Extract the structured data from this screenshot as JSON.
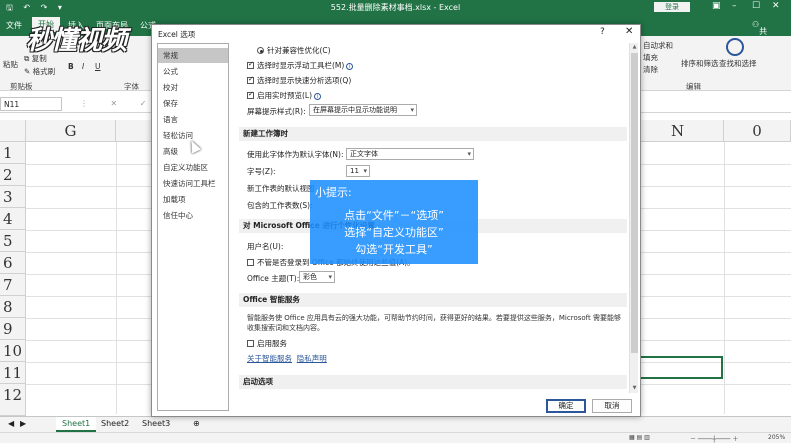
{
  "app": {
    "doc_title": "552.批量删除素材事档.xlsx  -  Excel",
    "login_label": "登录",
    "share_label": "共享",
    "tabs": [
      "文件",
      "开始",
      "插入",
      "页面布局",
      "公式"
    ],
    "brand_color": "#217346"
  },
  "ribbon": {
    "paste_label": "粘贴",
    "copy_label": "复制",
    "format_painter_label": "格式刷",
    "clipboard_group": "剪贴板",
    "bold": "B",
    "italic": "I",
    "underline": "U",
    "font_group": "字体",
    "autosum_label": "自动求和",
    "fill_label": "填充",
    "clear_label": "清除",
    "sort_label": "排序和筛选",
    "find_label": "查找和选择",
    "edit_group": "编辑",
    "watermark": "秒懂视频"
  },
  "formula_bar": {
    "name_box": "N11",
    "fx": "fx"
  },
  "grid": {
    "col_G": "G",
    "col_N": "N",
    "col_O": "0",
    "rows": [
      "1",
      "2",
      "3",
      "4",
      "5",
      "6",
      "7",
      "8",
      "9",
      "10",
      "11",
      "12"
    ]
  },
  "sheets": [
    "Sheet1",
    "Sheet2",
    "Sheet3"
  ],
  "status": {
    "zoom": "205%"
  },
  "dialog": {
    "title": "Excel 选项",
    "help": "?",
    "close": "✕",
    "nav": [
      "常规",
      "公式",
      "校对",
      "保存",
      "语言",
      "轻松访问",
      "高级",
      "自定义功能区",
      "快速访问工具栏",
      "加载项",
      "信任中心"
    ],
    "active_nav": "常规",
    "options": {
      "compat": "针对兼容性优化(C)",
      "mini_toolbar": "选择时显示浮动工具栏(M)",
      "quick_analysis": "选择时显示快速分析选项(Q)",
      "live_preview": "启用实时预览(L)",
      "screentip_label": "屏幕提示样式(R):",
      "screentip_value": "在屏幕提示中显示功能说明"
    },
    "new_workbook": {
      "section": "新建工作簿时",
      "font_label": "使用此字体作为默认字体(N):",
      "font_value": "正文字体",
      "size_label": "字号(Z):",
      "size_value": "11",
      "view_label": "新工作表的默认视图",
      "sheets_label": "包含的工作表数(S):"
    },
    "personalize": {
      "section": "对 Microsoft Office 进行个性化设置",
      "username_label": "用户名(U):",
      "always_use": "不管是否登录到 Office 都始终使用这些值(A)。",
      "theme_label": "Office 主题(T):",
      "theme_value": "彩色"
    },
    "intelligent": {
      "section": "Office 智能服务",
      "desc": "智能服务使 Office 应用具有云的强大功能，可帮助节约时间，获得更好的结果。若要提供这些服务，Microsoft 需要能够收集搜索词和文档内容。",
      "enable": "启用服务",
      "about_link": "关于智能服务",
      "privacy_link": "隐私声明"
    },
    "startup": {
      "section": "启动选项"
    },
    "ok": "确定",
    "cancel": "取消"
  },
  "tip": {
    "title": "小提示:",
    "line1": "点击“文件”－“选项”",
    "line2": "选择“自定义功能区”",
    "line3": "勾选“开发工具”"
  }
}
